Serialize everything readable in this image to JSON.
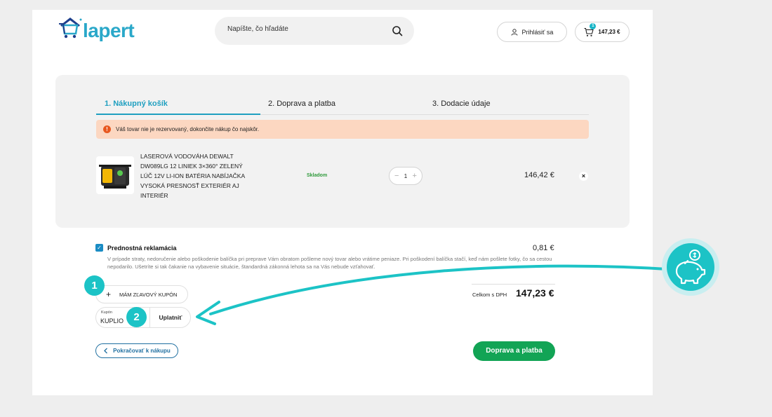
{
  "header": {
    "logo_text": "lapert",
    "search_placeholder": "Napíšte, čo hľadáte",
    "login_label": "Prihlásiť sa",
    "cart_total": "147,23 €",
    "cart_count": "1"
  },
  "steps": [
    {
      "label": "1. Nákupný košík",
      "active": true
    },
    {
      "label": "2. Doprava a platba",
      "active": false
    },
    {
      "label": "3. Dodacie údaje",
      "active": false
    }
  ],
  "alert": {
    "icon": "!",
    "text": "Váš tovar nie je rezervovaný, dokončite nákup čo najskôr."
  },
  "product": {
    "name": "LASEROVÁ VODOVÁHA DEWALT DW089LG 12 LINIEK 3×360° ZELENÝ LÚČ 12V LI-ION BATÉRIA NABÍJAČKA VYSOKÁ PRESNOSŤ EXTERIÉR AJ INTERIÉR",
    "stock": "Skladom",
    "quantity": "1",
    "qty_minus": "−",
    "qty_plus": "+",
    "price": "146,42 €",
    "remove": "×"
  },
  "reklamacia": {
    "checked_mark": "✓",
    "title": "Prednostná reklamácia",
    "price": "0,81 €",
    "description": "V prípade straty, nedoručenie alebo poškodenie balíčka pri preprave Vám obratom pošleme nový tovar alebo vrátime peniaze. Pri poškodení balíčka stačí, keď nám pošlete fotky, čo sa cestou nepodarilo. Ušetríte si tak čakanie na vybavenie situácie, štandardná zákonná lehota sa na Vás nebude vzťahovať."
  },
  "coupon": {
    "toggle_plus": "+",
    "toggle_label": "MÁM ZĽAVOVÝ KUPÓN",
    "field_label": "Kupón",
    "value": "KUPLIO",
    "apply_label": "Uplatniť"
  },
  "totals": {
    "label": "Celkom s DPH",
    "amount": "147,23 €"
  },
  "actions": {
    "continue_label": "Pokračovať k nákupu",
    "next_label": "Doprava a platba"
  },
  "annotations": {
    "badge_1": "1",
    "badge_2": "2",
    "accent_color": "#1cc3c6"
  },
  "colors": {
    "brand": "#2aa8c9",
    "primary_button": "#12a455",
    "alert_bg": "#fcd7c1",
    "step_active": "#1f9fc0"
  }
}
